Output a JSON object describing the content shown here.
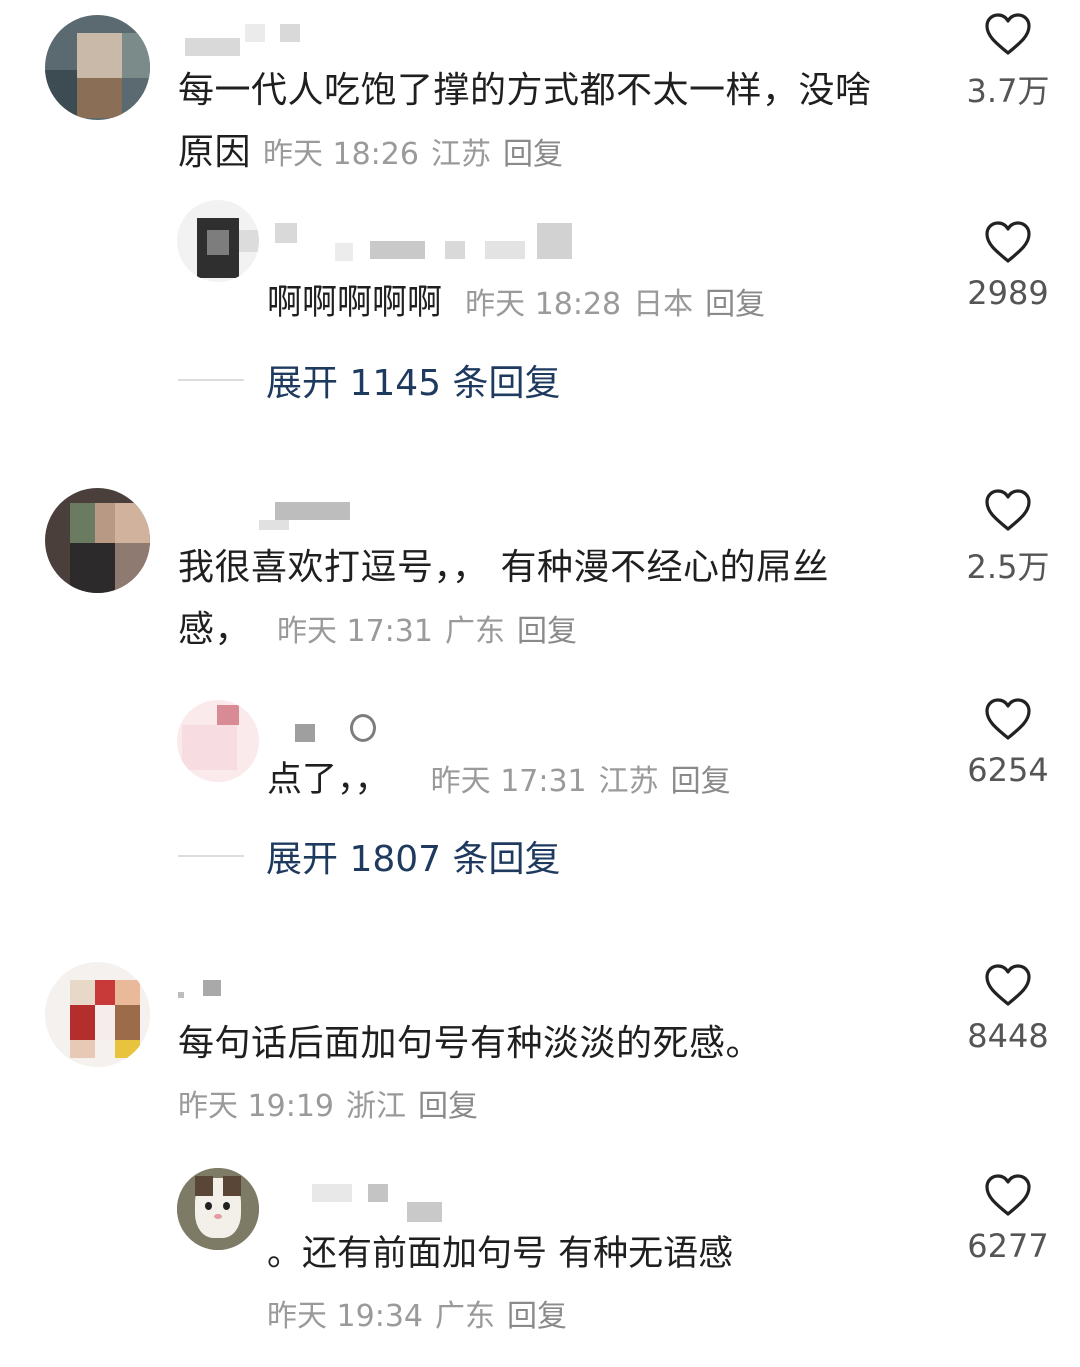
{
  "comments": [
    {
      "text": "每一代人吃饱了撑的方式都不太一样，没啥原因",
      "text_line1": "每一代人吃饱了撑的方式都不太一样，没啥",
      "text_line2": "原因",
      "time": "昨天 18:26",
      "location": "江苏",
      "reply_label": "回复",
      "likes": "3.7万",
      "reply": {
        "text": "啊啊啊啊啊",
        "time": "昨天 18:28",
        "location": "日本",
        "reply_label": "回复",
        "likes": "2989"
      },
      "expand_label": "展开 1145 条回复"
    },
    {
      "text": "我很喜欢打逗号，，有种漫不经心的屌丝感，",
      "text_line1": "我很喜欢打逗号，， 有种漫不经心的屌丝",
      "text_line2": "感，",
      "time": "昨天 17:31",
      "location": "广东",
      "reply_label": "回复",
      "likes": "2.5万",
      "reply": {
        "text": "点了，，",
        "time": "昨天 17:31",
        "location": "江苏",
        "reply_label": "回复",
        "likes": "6254"
      },
      "expand_label": "展开 1807 条回复"
    },
    {
      "text": "每句话后面加句号有种淡淡的死感。",
      "time": "昨天 19:19",
      "location": "浙江",
      "reply_label": "回复",
      "likes": "8448",
      "reply": {
        "text": "。还有前面加句号 有种无语感",
        "time": "昨天 19:34",
        "location": "广东",
        "reply_label": "回复",
        "likes": "6277"
      }
    }
  ],
  "icons": {
    "like": "heart-outline-icon"
  },
  "colors": {
    "text": "#1f1f1f",
    "meta": "#9a9a9a",
    "expand": "#1e3a5f",
    "like_count": "#555555"
  }
}
